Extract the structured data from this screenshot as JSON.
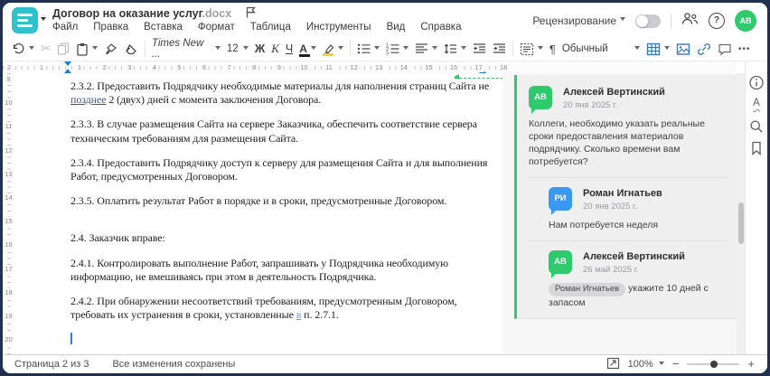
{
  "window": {
    "doc_title": "Договор на оказание услуг",
    "doc_ext": ".docx"
  },
  "menu_items": [
    "Файл",
    "Правка",
    "Вставка",
    "Формат",
    "Таблица",
    "Инструменты",
    "Вид",
    "Справка"
  ],
  "header": {
    "review_label": "Рецензирование",
    "user_initials": "АВ"
  },
  "toolbar": {
    "font_name": "Times New ...",
    "font_size": "12",
    "bold_label": "Ж",
    "italic_label": "К",
    "underline_label": "Ч",
    "font_color_label": "А",
    "para_mark_label": "¶",
    "style_name": "Обычный",
    "more_label": "•••"
  },
  "ruler": {
    "h_margin_numbers": [
      "2",
      "1"
    ],
    "h_numbers": [
      "1",
      "2",
      "3",
      "4",
      "5",
      "6",
      "7",
      "8",
      "9",
      "10",
      "11",
      "12",
      "13",
      "14",
      "15",
      "16",
      "17",
      "18"
    ],
    "v_numbers": [
      "9",
      "10",
      "11",
      "12",
      "13",
      "14",
      "15",
      "16",
      "17",
      "18",
      "19",
      "20"
    ]
  },
  "document": {
    "paragraphs": [
      {
        "segments": [
          {
            "text": "2.3.2. Предоставить Подрядчику необходимые материалы для наполнения страниц Сайта не "
          },
          {
            "text": "позднее",
            "style": "inserted"
          },
          {
            "text": " 2 (двух) дней с момента заключения Договора."
          }
        ]
      },
      {
        "segments": [
          {
            "text": "2.3.3. В случае размещения Сайта на сервере Заказчика, обеспечить соответствие сервера техническим требованиям для размещения Сайта."
          }
        ]
      },
      {
        "segments": [
          {
            "text": "2.3.4. Предоставить Подрядчику доступ к серверу для размещения Сайта и для выполнения Работ, предусмотренных Договором."
          }
        ]
      },
      {
        "segments": [
          {
            "text": "2.3.5. Оплатить результат Работ в порядке и в сроки, предусмотренные Договором."
          }
        ]
      },
      {
        "segments": [
          {
            "text": ""
          }
        ],
        "spacer": true
      },
      {
        "segments": [
          {
            "text": "2.4. Заказчик вправе:"
          }
        ]
      },
      {
        "segments": [
          {
            "text": "2.4.1. Контролировать выполнение Работ, запрашивать у Подрядчика необходимую информацию, не вмешиваясь при этом в деятельность Подрядчика."
          }
        ]
      },
      {
        "segments": [
          {
            "text": "2.4.2. При обнаружении несоответствий требованиям, предусмотренным Договором, требовать их устранения в сроки, установленные "
          },
          {
            "text": "в",
            "style": "inserted-alt"
          },
          {
            "text": " п. 2.7.1."
          }
        ]
      },
      {
        "segments": [
          {
            "text": ""
          }
        ],
        "cursor": true
      }
    ]
  },
  "comments": {
    "thread": [
      {
        "initials": "АВ",
        "color": "#2fca6e",
        "name": "Алексей Вертинский",
        "date": "20 янв 2025 г.",
        "reply": false,
        "text": "Коллеги, необходимо указать реальные сроки предоставления материалов подрядчику. Сколько времени вам потребуется?"
      },
      {
        "initials": "РИ",
        "color": "#3a97f2",
        "name": "Роман Игнатьев",
        "date": "20 янв 2025 г.",
        "reply": true,
        "text": "Нам потребуется неделя"
      },
      {
        "initials": "АВ",
        "color": "#2fca6e",
        "name": "Алексей Вертинский",
        "date": "26 май 2025 г.",
        "reply": true,
        "mention": "Роман Игнатьев",
        "text": "укажите 10 дней с запасом"
      }
    ]
  },
  "side_panel_icons": [
    "info",
    "spellcheck",
    "search",
    "bookmark"
  ],
  "sidebar": {
    "spellcheck_letter": "А"
  },
  "statusbar": {
    "page_label": "Страница 2 из 3",
    "saved_label": "Все изменения сохранены",
    "zoom_value": "100%",
    "zoom_out": "−",
    "zoom_in": "+"
  },
  "misc": {
    "help_label": "?",
    "info_letter": "i"
  },
  "colors": {
    "accent_teal": "#2fc1cc",
    "review_green": "#2fca6e",
    "toolbar_blue": "#3e78b5",
    "frame_navy": "#223050"
  }
}
